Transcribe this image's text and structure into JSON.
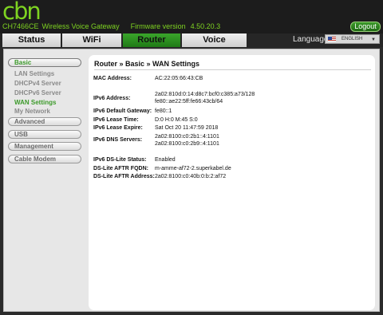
{
  "header": {
    "logo": "cbn",
    "model": "CH7466CE",
    "product": "Wireless Voice Gateway",
    "firmware_label": "Firmware version",
    "firmware": "4.50.20.3",
    "logout": "Logout"
  },
  "tabs": [
    {
      "label": "Status"
    },
    {
      "label": "WiFi"
    },
    {
      "label": "Router"
    },
    {
      "label": "Voice"
    }
  ],
  "language": {
    "label": "Language",
    "selected": "ENGLISH"
  },
  "sidebar": {
    "basic": "Basic",
    "basic_items": [
      "LAN Settings",
      "DHCPv4 Server",
      "DHCPv6 Server",
      "WAN Settings",
      "My Network"
    ],
    "advanced": "Advanced",
    "usb": "USB",
    "management": "Management",
    "cable_modem": "Cable Modem"
  },
  "main": {
    "breadcrumb": "Router » Basic » WAN Settings",
    "mac_label": "MAC Address:",
    "mac": "AC:22:05:66:43:CB",
    "ipv6_label": "IPv6 Address:",
    "ipv6_1": "2a02:810d:0:14:d8c7:bcf0:c385:a73/128",
    "ipv6_2": "fe80::ae22:5ff:fe66:43cb/64",
    "gateway_label": "IPv6 Default Gateway:",
    "gateway": "fe80::1",
    "lease_time_label": "IPv6 Lease Time:",
    "lease_time": "D:0 H:0 M:45 S:0",
    "lease_expire_label": "IPv6 Lease Expire:",
    "lease_expire": "Sat Oct 20 11:47:59 2018",
    "dns_label": "IPv6 DNS Servers:",
    "dns_1": "2a02:8100:c0:2b1::4:1101",
    "dns_2": "2a02:8100:c0:2b9::4:1101",
    "dslite_status_label": "IPv6 DS-Lite Status:",
    "dslite_status": "Enabled",
    "aftr_fqdn_label": "DS-Lite AFTR FQDN:",
    "aftr_fqdn": "m-amme-af72-2.superkabel.de",
    "aftr_addr_label": "DS-Lite AFTR Address:",
    "aftr_addr": "2a02:8100:c0:40b:0:b:2:af72"
  }
}
